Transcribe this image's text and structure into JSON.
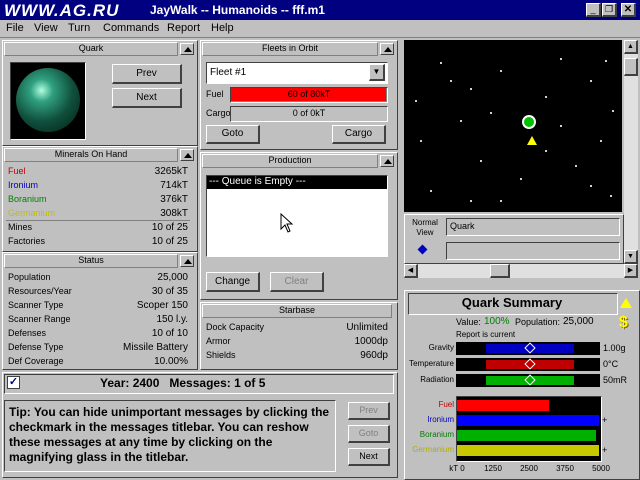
{
  "window": {
    "title": "JayWalk -- Humanoids -- fff.m1",
    "watermark": "WWW.AG.RU"
  },
  "menu": [
    "File",
    "View",
    "Turn",
    "Commands",
    "Report",
    "Help"
  ],
  "planet": {
    "title": "Quark",
    "prev": "Prev",
    "next": "Next"
  },
  "minerals": {
    "title": "Minerals On Hand",
    "rows": [
      {
        "label": "Fuel",
        "value": "3265kT",
        "color": "#c00000"
      },
      {
        "label": "Ironium",
        "value": "714kT",
        "color": "#0000c0"
      },
      {
        "label": "Boranium",
        "value": "376kT",
        "color": "#008000"
      },
      {
        "label": "Germanium",
        "value": "308kT",
        "color": "#c0c000"
      },
      {
        "label": "Mines",
        "value": "10 of 25",
        "color": "#000000"
      },
      {
        "label": "Factories",
        "value": "10 of 25",
        "color": "#000000"
      }
    ]
  },
  "status": {
    "title": "Status",
    "rows": [
      {
        "label": "Population",
        "value": "25,000"
      },
      {
        "label": "Resources/Year",
        "value": "30 of 35"
      },
      {
        "label": "Scanner Type",
        "value": "Scoper 150"
      },
      {
        "label": "Scanner Range",
        "value": "150 l.y."
      },
      {
        "label": "Defenses",
        "value": "10 of 10"
      },
      {
        "label": "Defense Type",
        "value": "Missile Battery"
      },
      {
        "label": "Def Coverage",
        "value": "10.00%"
      }
    ]
  },
  "fleets": {
    "title": "Fleets in Orbit",
    "selected": "Fleet #1",
    "fuel_label": "Fuel",
    "fuel_value": "60 of 80kT",
    "fuel_fraction": 1.0,
    "cargo_label": "Cargo",
    "cargo_value": "0 of 0kT",
    "goto": "Goto",
    "cargo": "Cargo"
  },
  "production": {
    "title": "Production",
    "queue": "--- Queue is Empty ---",
    "change": "Change",
    "clear": "Clear"
  },
  "starbase": {
    "title": "Starbase",
    "rows": [
      {
        "label": "Dock Capacity",
        "value": "Unlimited"
      },
      {
        "label": "Armor",
        "value": "1000dp"
      },
      {
        "label": "Shields",
        "value": "960dp"
      }
    ]
  },
  "messages": {
    "header": "Year: 2400   Messages: 1 of 5",
    "body": "Tip: You can hide unimportant messages by clicking the checkmark in the messages titlebar. You can reshow these messages at any time by clicking on the magnifying glass in the titlebar.",
    "prev": "Prev",
    "goto": "Goto",
    "next": "Next"
  },
  "map": {
    "normal_view": "Normal View",
    "selected_name": "Quark"
  },
  "summary": {
    "title": "Quark Summary",
    "value_label": "Value:",
    "value": "100%",
    "pop_label": "Population:",
    "pop": "25,000",
    "report": "Report is current",
    "env": [
      {
        "label": "Gravity",
        "value": "1.00g",
        "marker": 0.5,
        "color": "#0000c0"
      },
      {
        "label": "Temperature",
        "value": "0°C",
        "marker": 0.5,
        "color": "#c00000"
      },
      {
        "label": "Radiation",
        "value": "50mR",
        "marker": 0.5,
        "color": "#00b000"
      }
    ],
    "bars": [
      {
        "label": "Fuel",
        "color": "#ff0000",
        "fraction": 0.65,
        "text_color": "#c00000"
      },
      {
        "label": "Ironium",
        "color": "#0000ff",
        "fraction": 1.0,
        "text_color": "#0000c0"
      },
      {
        "label": "Boranium",
        "color": "#00b000",
        "fraction": 0.98,
        "text_color": "#008000"
      },
      {
        "label": "Germanium",
        "color": "#c8c800",
        "fraction": 1.0,
        "text_color": "#b0b000"
      }
    ],
    "axis": [
      "kT 0",
      "1250",
      "2500",
      "3750",
      "5000"
    ]
  },
  "colors": {
    "titlebar": "#000080",
    "accent_yellow": "#ffff00"
  }
}
